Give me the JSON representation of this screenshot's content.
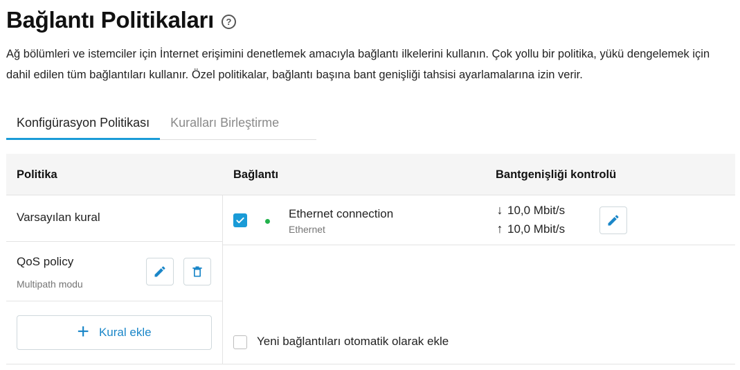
{
  "page": {
    "title": "Bağlantı Politikaları",
    "help_icon": "help-circle-icon",
    "description": "Ağ bölümleri ve istemciler için İnternet erişimini denetlemek amacıyla bağlantı ilkelerini kullanın. Çok yollu bir politika, yükü dengelemek için dahil edilen tüm bağlantıları kullanır. Özel politikalar, bağlantı başına bant genişliği tahsisi ayarlamalarına izin verir."
  },
  "tabs": [
    {
      "label": "Konfigürasyon Politikası",
      "active": true
    },
    {
      "label": "Kuralları Birleştirme",
      "active": false
    }
  ],
  "table": {
    "headers": {
      "policy": "Politika",
      "connection": "Bağlantı",
      "bandwidth": "Bantgenişliği kontrolü"
    },
    "policies": [
      {
        "name": "Varsayılan kural",
        "subtitle": ""
      },
      {
        "name": "QoS policy",
        "subtitle": "Multipath modu"
      }
    ],
    "connection": {
      "checked": true,
      "status": "connected",
      "status_color": "#22b24c",
      "name": "Ethernet connection",
      "type": "Ethernet",
      "download": "10,0 Mbit/s",
      "upload": "10,0 Mbit/s",
      "download_icon": "arrow-down-icon",
      "upload_icon": "arrow-up-icon"
    },
    "add_rule_label": "Kural ekle",
    "auto_add_label": "Yeni bağlantıları otomatik olarak ekle",
    "auto_add_checked": false
  },
  "colors": {
    "accent": "#1a9bd7",
    "link": "#1a86c8",
    "header_bg": "#f5f5f5"
  }
}
